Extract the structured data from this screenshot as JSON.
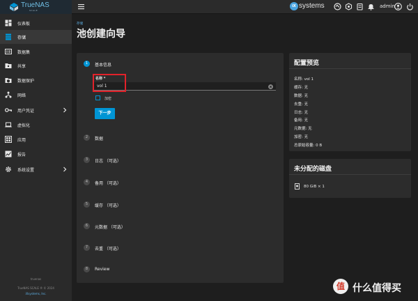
{
  "brand": {
    "name": "TrueNAS",
    "sub": "SCALE"
  },
  "header": {
    "vendor": "systems",
    "vendor_mark": "iX",
    "user": "admin",
    "accent": "#0095d5"
  },
  "sidebar": {
    "items": [
      {
        "label": "仪表板",
        "icon": "dashboard-icon"
      },
      {
        "label": "存储",
        "icon": "storage-icon",
        "active": true
      },
      {
        "label": "数据集",
        "icon": "dataset-icon"
      },
      {
        "label": "共享",
        "icon": "share-icon"
      },
      {
        "label": "数据保护",
        "icon": "data-protection-icon"
      },
      {
        "label": "网络",
        "icon": "network-icon"
      },
      {
        "label": "用户凭证",
        "icon": "credentials-icon",
        "expandable": true
      },
      {
        "label": "虚拟化",
        "icon": "virtualization-icon"
      },
      {
        "label": "应用",
        "icon": "apps-icon"
      },
      {
        "label": "报告",
        "icon": "reports-icon"
      },
      {
        "label": "系统设置",
        "icon": "system-settings-icon",
        "expandable": true
      }
    ],
    "footer": {
      "hostname": "truenas",
      "copyright": "TrueNAS SCALE ® © 2024",
      "company": "iXsystems, Inc."
    }
  },
  "page": {
    "breadcrumb": "存储",
    "title": "池创建向导"
  },
  "wizard": {
    "steps": [
      {
        "num": "1",
        "title": "基本信息"
      },
      {
        "num": "2",
        "title": "数据"
      },
      {
        "num": "3",
        "title": "日志 （可选）"
      },
      {
        "num": "4",
        "title": "备用 （可选）"
      },
      {
        "num": "5",
        "title": "缓存 （可选）"
      },
      {
        "num": "6",
        "title": "元数据 （可选）"
      },
      {
        "num": "7",
        "title": "去重 （可选）"
      },
      {
        "num": "8",
        "title": "Review"
      }
    ],
    "name_label": "名称 *",
    "name_value": "vol 1",
    "encrypt_label": "加密",
    "encrypt_checked": false,
    "next_button": "下一步"
  },
  "summary": {
    "title": "配置预览",
    "rows": [
      "名称: vol 1",
      "缓存: 无",
      "数据: 无",
      "去重: 无",
      "日志: 无",
      "备用: 无",
      "元数据: 无",
      "加密: 无",
      "总原始容量: 0 B"
    ]
  },
  "unassigned": {
    "title": "未分配的磁盘",
    "disk": "80 GiB × 1"
  },
  "watermark": {
    "mark": "值",
    "text": "什么值得买"
  }
}
